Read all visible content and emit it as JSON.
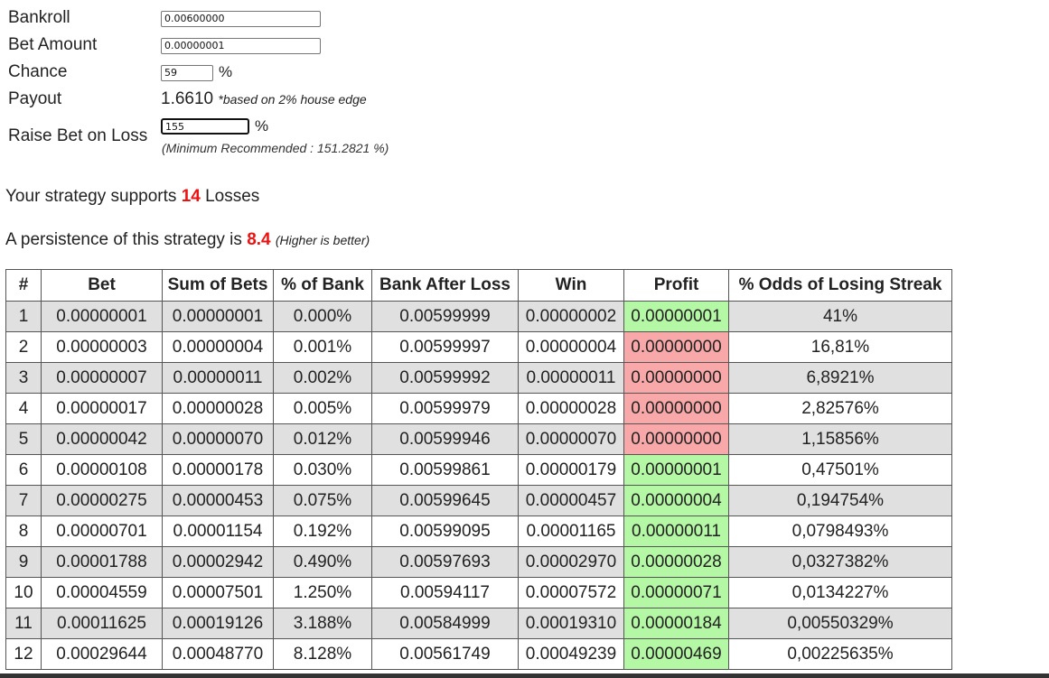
{
  "form": {
    "bankroll_label": "Bankroll",
    "bankroll_value": "0.00600000",
    "bet_amount_label": "Bet Amount",
    "bet_amount_value": "0.00000001",
    "chance_label": "Chance",
    "chance_value": "59",
    "chance_unit": "%",
    "payout_label": "Payout",
    "payout_value": "1.6610",
    "payout_note": "*based on 2% house edge",
    "raise_label": "Raise Bet on Loss",
    "raise_value": "155",
    "raise_unit": "%",
    "raise_min_note": "(Minimum Recommended : 151.2821 %)"
  },
  "summary": {
    "supports_prefix": "Your strategy supports",
    "supports_value": "14",
    "supports_suffix": "Losses",
    "persistence_prefix": "A persistence of this strategy is",
    "persistence_value": "8.4",
    "persistence_note": "(Higher is better)"
  },
  "table": {
    "headers": [
      "#",
      "Bet",
      "Sum of Bets",
      "% of Bank",
      "Bank After Loss",
      "Win",
      "Profit",
      "% Odds of Losing Streak"
    ],
    "rows": [
      {
        "n": "1",
        "bet": "0.00000001",
        "sum": "0.00000001",
        "pct": "0.000%",
        "bank": "0.00599999",
        "win": "0.00000002",
        "profit": "0.00000001",
        "profit_status": "positive",
        "odds": "41%"
      },
      {
        "n": "2",
        "bet": "0.00000003",
        "sum": "0.00000004",
        "pct": "0.001%",
        "bank": "0.00599997",
        "win": "0.00000004",
        "profit": "0.00000000",
        "profit_status": "zero",
        "odds": "16,81%"
      },
      {
        "n": "3",
        "bet": "0.00000007",
        "sum": "0.00000011",
        "pct": "0.002%",
        "bank": "0.00599992",
        "win": "0.00000011",
        "profit": "0.00000000",
        "profit_status": "zero",
        "odds": "6,8921%"
      },
      {
        "n": "4",
        "bet": "0.00000017",
        "sum": "0.00000028",
        "pct": "0.005%",
        "bank": "0.00599979",
        "win": "0.00000028",
        "profit": "0.00000000",
        "profit_status": "zero",
        "odds": "2,82576%"
      },
      {
        "n": "5",
        "bet": "0.00000042",
        "sum": "0.00000070",
        "pct": "0.012%",
        "bank": "0.00599946",
        "win": "0.00000070",
        "profit": "0.00000000",
        "profit_status": "zero",
        "odds": "1,15856%"
      },
      {
        "n": "6",
        "bet": "0.00000108",
        "sum": "0.00000178",
        "pct": "0.030%",
        "bank": "0.00599861",
        "win": "0.00000179",
        "profit": "0.00000001",
        "profit_status": "positive",
        "odds": "0,47501%"
      },
      {
        "n": "7",
        "bet": "0.00000275",
        "sum": "0.00000453",
        "pct": "0.075%",
        "bank": "0.00599645",
        "win": "0.00000457",
        "profit": "0.00000004",
        "profit_status": "positive",
        "odds": "0,194754%"
      },
      {
        "n": "8",
        "bet": "0.00000701",
        "sum": "0.00001154",
        "pct": "0.192%",
        "bank": "0.00599095",
        "win": "0.00001165",
        "profit": "0.00000011",
        "profit_status": "positive",
        "odds": "0,0798493%"
      },
      {
        "n": "9",
        "bet": "0.00001788",
        "sum": "0.00002942",
        "pct": "0.490%",
        "bank": "0.00597693",
        "win": "0.00002970",
        "profit": "0.00000028",
        "profit_status": "positive",
        "odds": "0,0327382%"
      },
      {
        "n": "10",
        "bet": "0.00004559",
        "sum": "0.00007501",
        "pct": "1.250%",
        "bank": "0.00594117",
        "win": "0.00007572",
        "profit": "0.00000071",
        "profit_status": "positive",
        "odds": "0,0134227%"
      },
      {
        "n": "11",
        "bet": "0.00011625",
        "sum": "0.00019126",
        "pct": "3.188%",
        "bank": "0.00584999",
        "win": "0.00019310",
        "profit": "0.00000184",
        "profit_status": "positive",
        "odds": "0,00550329%"
      },
      {
        "n": "12",
        "bet": "0.00029644",
        "sum": "0.00048770",
        "pct": "8.128%",
        "bank": "0.00561749",
        "win": "0.00049239",
        "profit": "0.00000469",
        "profit_status": "positive",
        "odds": "0,00225635%"
      }
    ]
  },
  "colors": {
    "highlight_red": "#ee1111",
    "profit_positive_bg": "#b4f7a4",
    "profit_zero_bg": "#f8a8a8",
    "alt_row_bg": "#e0e0e0"
  }
}
